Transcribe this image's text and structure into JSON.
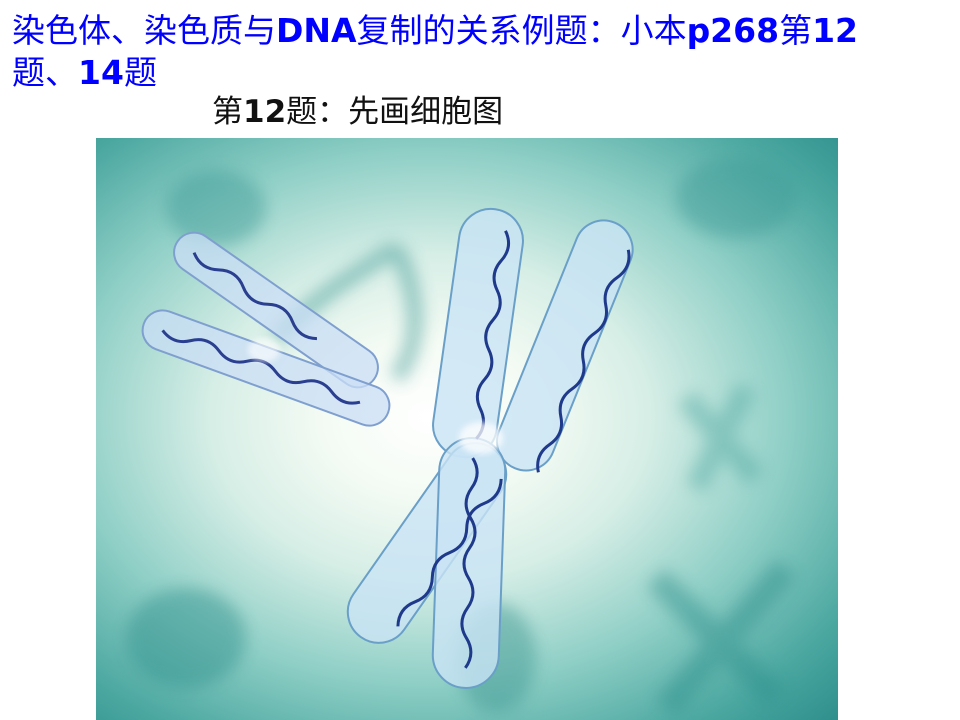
{
  "slide": {
    "title_part1": "染色体、染色质与",
    "title_part2": "DNA",
    "title_part3": "复制的关系例题：小本",
    "title_part4": "p268",
    "title_part5": "第",
    "title_part6": "12",
    "title_part7": "题、",
    "title_part8": "14",
    "title_part9": "题",
    "subtitle_prefix": "第",
    "subtitle_num": "12",
    "subtitle_suffix": "题：先画细胞图"
  },
  "figure": {
    "icon": "chromosome-illustration",
    "colors": {
      "background_center": "#ffffff",
      "background_edge": "#2f8f8c",
      "chromatid_fill": "#bfe0f2",
      "chromatid_stroke": "#6a9fc8",
      "dna_strand": "#1f3a8a"
    }
  }
}
